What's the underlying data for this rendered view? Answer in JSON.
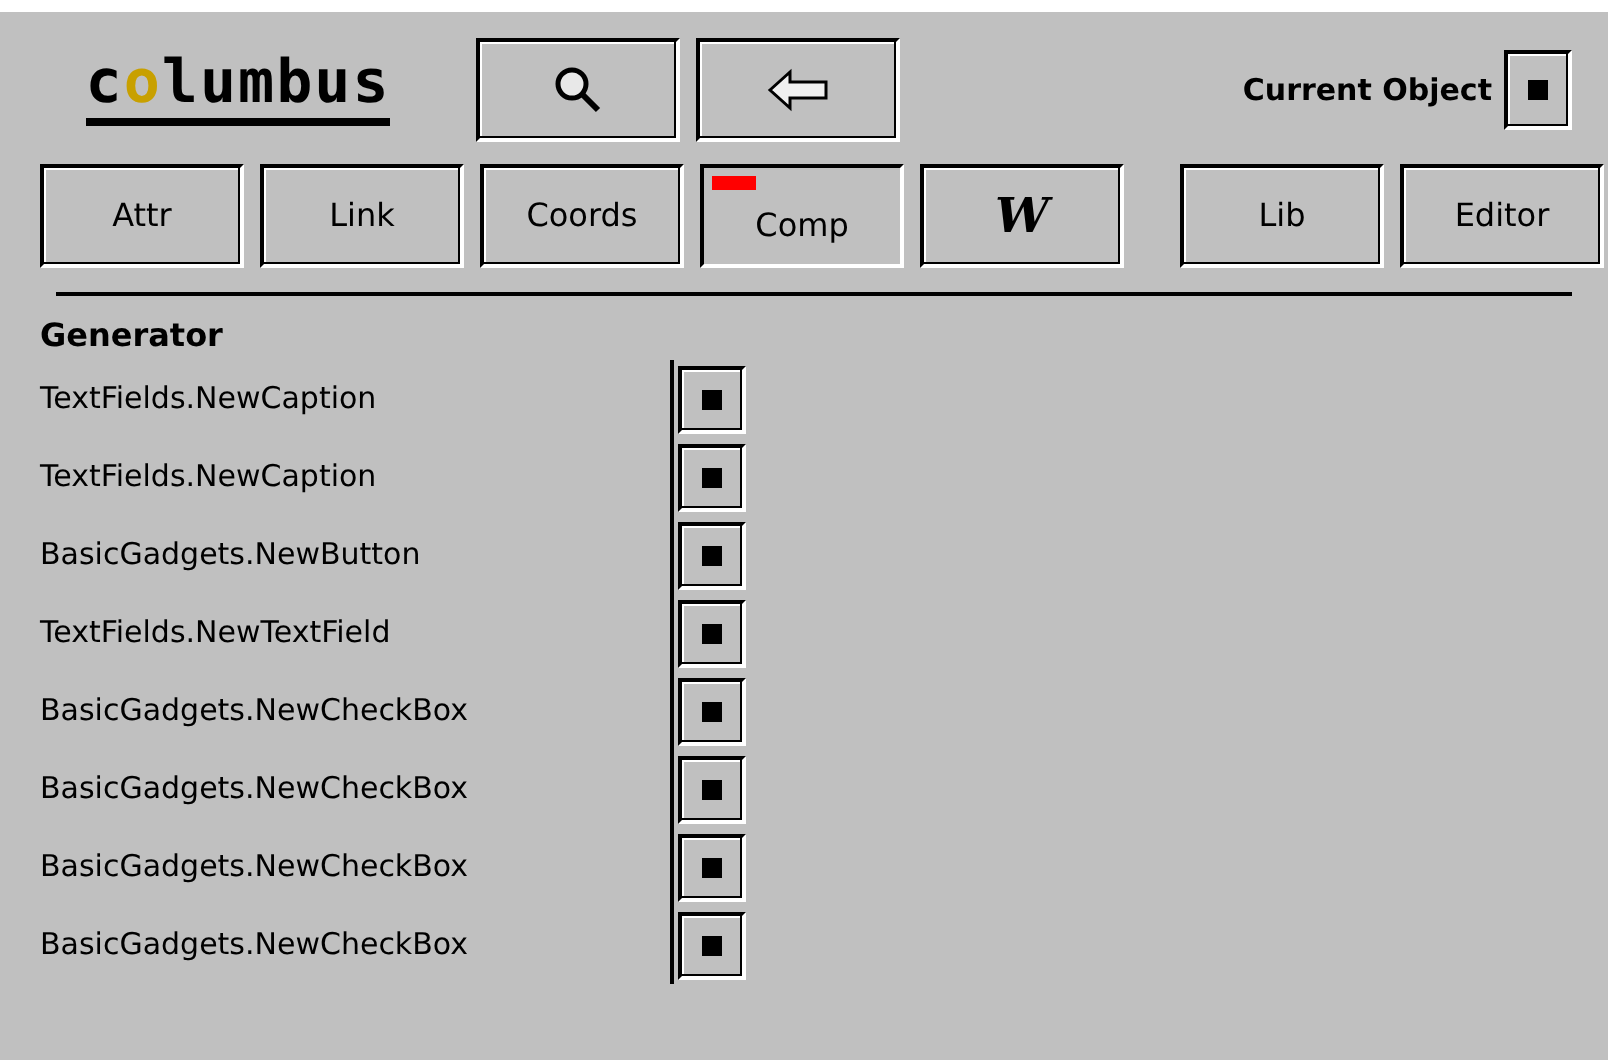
{
  "logo": "columbus",
  "toolbar": {
    "buttons": [
      {
        "kind": "search"
      },
      {
        "kind": "back"
      }
    ],
    "current_object_label": "Current Object"
  },
  "tabs": [
    {
      "label": "Attr",
      "selected": false
    },
    {
      "label": "Link",
      "selected": false
    },
    {
      "label": "Coords",
      "selected": false
    },
    {
      "label": "Comp",
      "selected": true
    },
    {
      "label": "W",
      "selected": false
    },
    {
      "label": "Lib",
      "selected": false
    },
    {
      "label": "Editor",
      "selected": false
    }
  ],
  "section": {
    "title": "Generator"
  },
  "rows": [
    {
      "name": "TextFields.NewCaption"
    },
    {
      "name": "TextFields.NewCaption"
    },
    {
      "name": "BasicGadgets.NewButton"
    },
    {
      "name": "TextFields.NewTextField"
    },
    {
      "name": "BasicGadgets.NewCheckBox"
    },
    {
      "name": "BasicGadgets.NewCheckBox"
    },
    {
      "name": "BasicGadgets.NewCheckBox"
    },
    {
      "name": "BasicGadgets.NewCheckBox"
    }
  ]
}
